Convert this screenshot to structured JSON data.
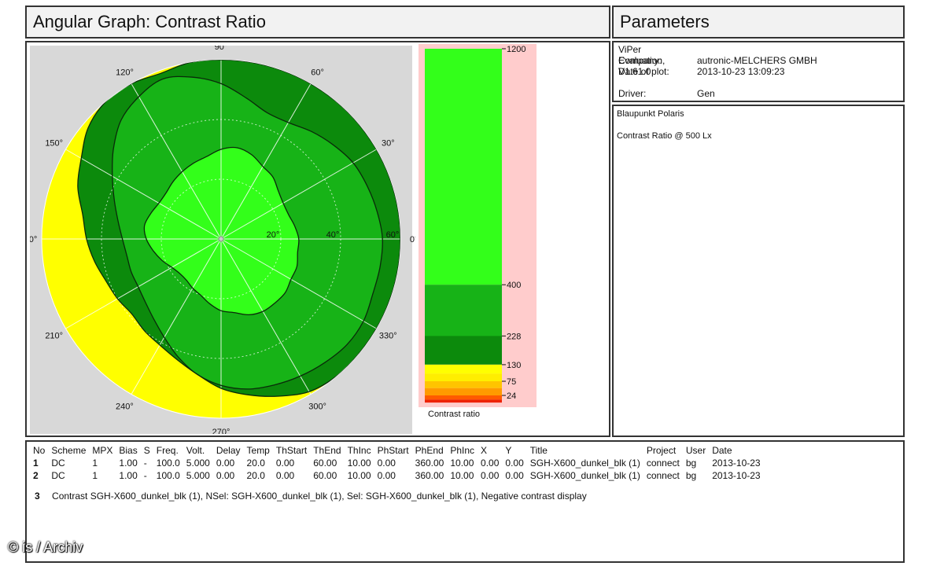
{
  "header": {
    "left_title": "Angular Graph: Contrast Ratio",
    "right_title": "Parameters"
  },
  "meta": {
    "software": "ViPer Evaluation, V1.61.0",
    "company_label": "Company:",
    "company_value": "autronic-MELCHERS GMBH",
    "date_label": "Date of plot:",
    "date_value": "2013-10-23 13:09:23",
    "driver_label": "Driver:",
    "driver_value": "Gen"
  },
  "description": {
    "device": "Blaupunkt Polaris",
    "measurement": "Contrast Ratio @ 500 Lx"
  },
  "chart_data": {
    "type": "polar",
    "title": "Angular Graph: Contrast Ratio",
    "angle_labels": [
      "90°",
      "60°",
      "30°",
      "0°",
      "330°",
      "300°",
      "270°",
      "240°",
      "210°",
      "180°",
      "150°",
      "120°"
    ],
    "angles_deg": [
      90,
      60,
      30,
      0,
      330,
      300,
      270,
      240,
      210,
      180,
      150,
      120
    ],
    "radius_labels": [
      "20°",
      "40°",
      "60°"
    ],
    "radius_max_deg": 60,
    "grid": true,
    "colors": {
      "yellow": "#ffff00",
      "dark_green": "#0c8a0c",
      "mid_green": "#17b317",
      "light_green": "#22dd22",
      "bright_green": "#33ff1a",
      "plot_bg": "#d8d8d8",
      "legend_bg": "#ffcccc"
    },
    "contours": [
      {
        "level": 130,
        "radii_deg": [
          60,
          60,
          60,
          60,
          60,
          60,
          60,
          60,
          60,
          60,
          60,
          59,
          60,
          60,
          58,
          54,
          51,
          47,
          45,
          43,
          41,
          40,
          39,
          40,
          41,
          43,
          46,
          50,
          53,
          56,
          59,
          60,
          60,
          60,
          60,
          60
        ]
      },
      {
        "level": 228,
        "radii_deg": [
          54,
          53,
          52,
          51,
          49,
          47,
          45,
          45,
          48,
          52,
          55,
          57,
          55,
          52,
          47,
          42,
          38,
          35,
          33,
          32,
          32,
          32,
          33,
          35,
          38,
          42,
          46,
          49,
          51,
          52,
          53,
          54,
          55,
          55,
          54,
          54
        ]
      },
      {
        "level": 400,
        "radii_deg": [
          26,
          25,
          24,
          24,
          25,
          27,
          28,
          30,
          31,
          30,
          28,
          27,
          26,
          25,
          24,
          24,
          25,
          26,
          25,
          23,
          21,
          19,
          18,
          18,
          19,
          20,
          22,
          24,
          25,
          27,
          28,
          28,
          28,
          27,
          27,
          26
        ]
      }
    ],
    "legend": {
      "title": "Contrast ratio",
      "levels": [
        1200,
        400,
        228,
        130,
        75,
        24
      ],
      "level_labels": [
        "1200",
        "400",
        "228",
        "130",
        "75",
        "24"
      ],
      "min": 0,
      "max": 1200
    }
  },
  "table": {
    "headers": [
      "No",
      "Scheme",
      "MPX",
      "Bias",
      "S",
      "Freq.",
      "Volt.",
      "Delay",
      "Temp",
      "ThStart",
      "ThEnd",
      "ThInc",
      "PhStart",
      "PhEnd",
      "PhInc",
      "X",
      "Y",
      "Title",
      "Project",
      "User",
      "Date"
    ],
    "rows": [
      [
        "1",
        "DC",
        "1",
        "1.00",
        "-",
        "100.0",
        "5.000",
        "0.00",
        "20.0",
        "0.00",
        "60.00",
        "10.00",
        "0.00",
        "360.00",
        "10.00",
        "0.00",
        "0.00",
        "SGH-X600_dunkel_blk (1)",
        "connect",
        "bg",
        "2013-10-23"
      ],
      [
        "2",
        "DC",
        "1",
        "1.00",
        "-",
        "100.0",
        "5.000",
        "0.00",
        "20.0",
        "0.00",
        "60.00",
        "10.00",
        "0.00",
        "360.00",
        "10.00",
        "0.00",
        "0.00",
        "SGH-X600_dunkel_blk (1)",
        "connect",
        "bg",
        "2013-10-23"
      ]
    ],
    "note_no": "3",
    "note_text": "Contrast SGH-X600_dunkel_blk (1), NSel: SGH-X600_dunkel_blk (1), Sel: SGH-X600_dunkel_blk (1), Negative contrast display"
  },
  "watermark": "© is / Archiv"
}
